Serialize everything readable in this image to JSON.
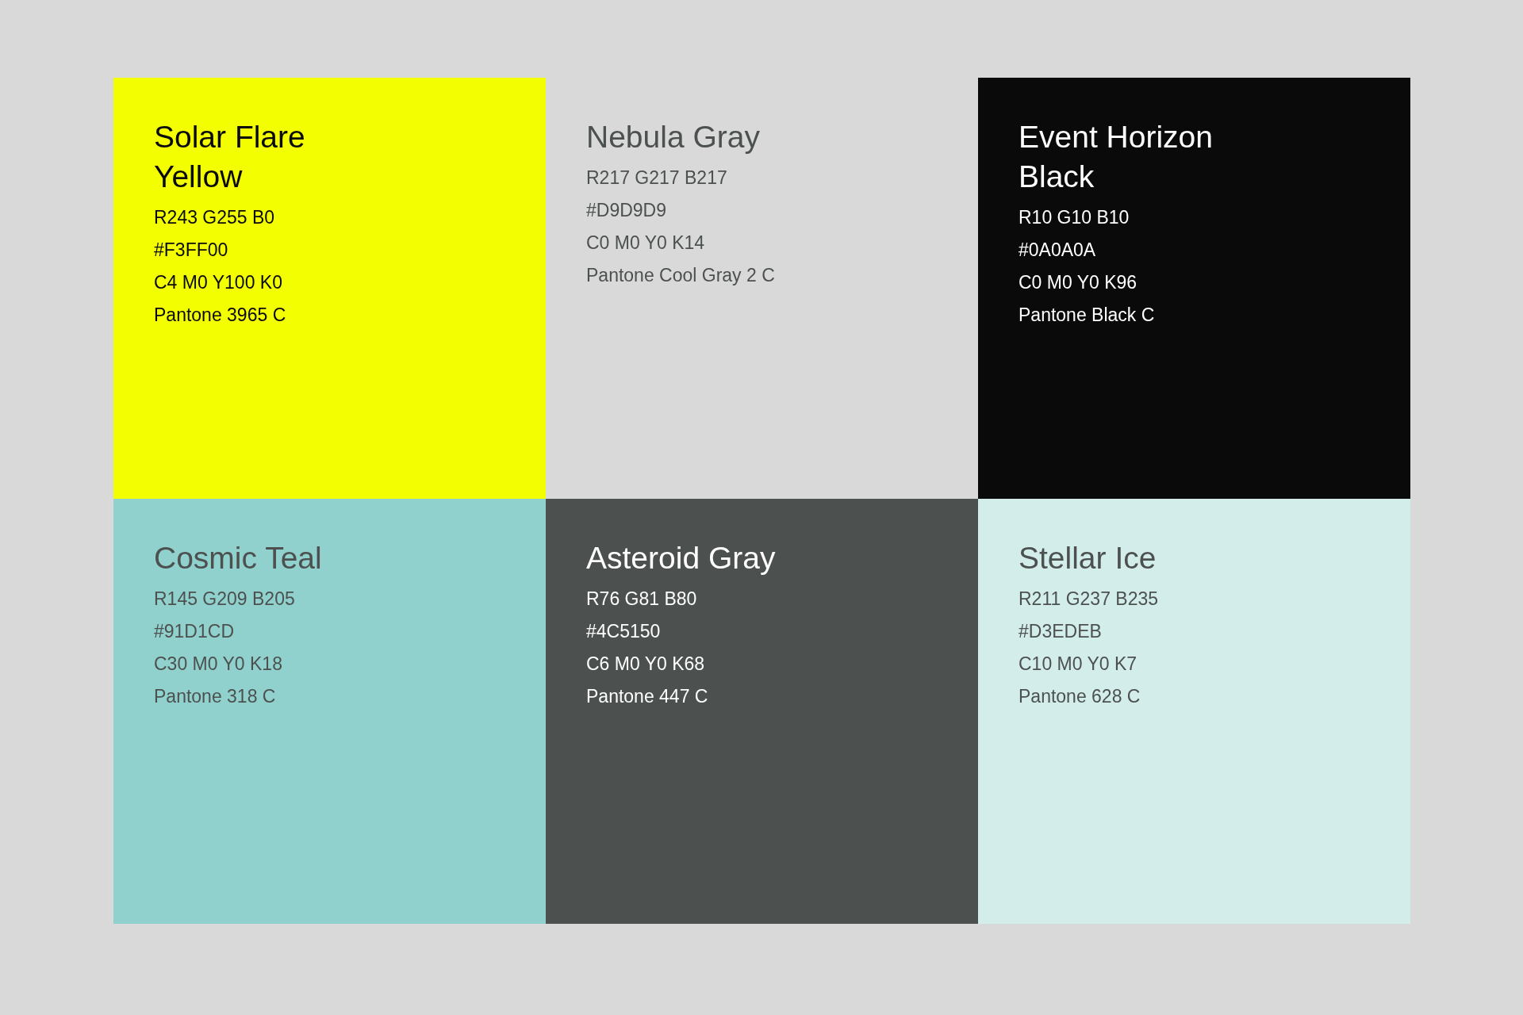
{
  "swatches": [
    {
      "name": "Solar Flare Yellow",
      "color": "#f3ff00",
      "kind": "dark",
      "specs": [
        "R243 G255 B0",
        "#F3FF00",
        "C4 M0 Y100 K0",
        "Pantone 3965 C"
      ]
    },
    {
      "name": "Nebula Gray",
      "color": "#d9d9d9",
      "kind": "muted",
      "specs": [
        "R217 G217 B217",
        "#D9D9D9",
        "C0 M0 Y0 K14",
        "Pantone Cool Gray 2 C"
      ]
    },
    {
      "name": "Event Horizon Black",
      "color": "#0a0a0a",
      "kind": "light",
      "specs": [
        "R10 G10 B10",
        "#0A0A0A",
        "C0 M0 Y0 K96",
        "Pantone Black C"
      ]
    },
    {
      "name": "Cosmic Teal",
      "color": "#91d1cd",
      "kind": "muted",
      "specs": [
        "R145 G209 B205",
        "#91D1CD",
        "C30 M0 Y0 K18",
        "Pantone 318 C"
      ]
    },
    {
      "name": "Asteroid Gray",
      "color": "#4c5150",
      "kind": "light",
      "specs": [
        "R76 G81 B80",
        "#4C5150",
        "C6 M0 Y0 K68",
        "Pantone 447 C"
      ]
    },
    {
      "name": "Stellar Ice",
      "color": "#d3edeb",
      "kind": "muted",
      "specs": [
        "R211 G237 B235",
        "#D3EDEB",
        "C10 M0 Y0 K7",
        "Pantone 628 C"
      ]
    }
  ]
}
